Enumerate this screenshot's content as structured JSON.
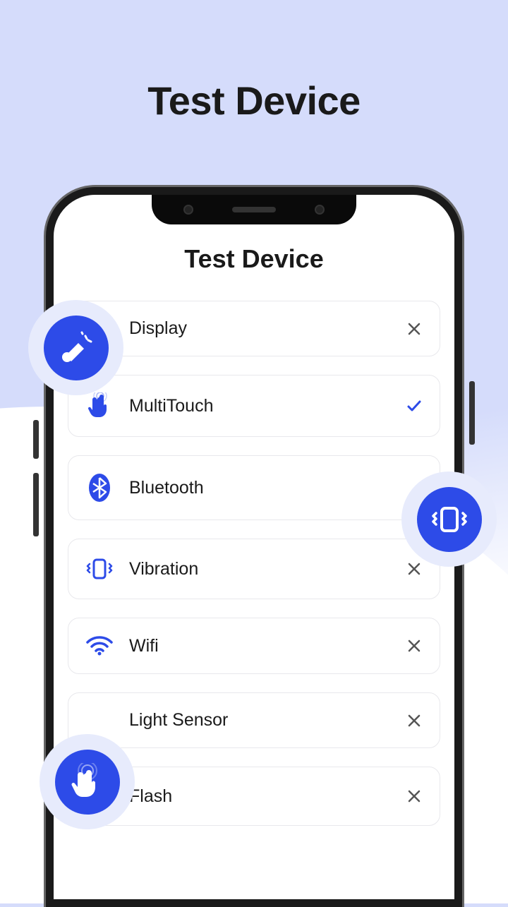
{
  "page": {
    "title": "Test Device",
    "app_title": "Test Device"
  },
  "tests": [
    {
      "label": "Display",
      "icon": "display",
      "status": "fail"
    },
    {
      "label": "MultiTouch",
      "icon": "multitouch",
      "status": "pass"
    },
    {
      "label": "Bluetooth",
      "icon": "bluetooth",
      "status": "none"
    },
    {
      "label": "Vibration",
      "icon": "vibration",
      "status": "fail"
    },
    {
      "label": "Wifi",
      "icon": "wifi",
      "status": "fail"
    },
    {
      "label": "Light Sensor",
      "icon": "lightsensor",
      "status": "fail"
    },
    {
      "label": "Flash",
      "icon": "flash",
      "status": "fail"
    }
  ],
  "colors": {
    "accent": "#2d4be8"
  }
}
